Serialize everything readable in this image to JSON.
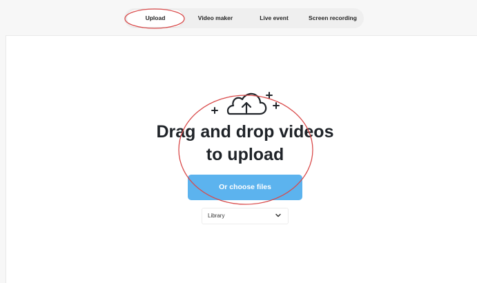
{
  "tabs": [
    {
      "label": "Upload"
    },
    {
      "label": "Video maker"
    },
    {
      "label": "Live event"
    },
    {
      "label": "Screen recording"
    }
  ],
  "upload": {
    "headline_line1": "Drag and drop videos",
    "headline_line2": "to upload",
    "choose_button": "Or choose files",
    "destination_value": "Library"
  },
  "icons": [
    "cloud-upload-icon",
    "plus-icon",
    "chevron-down-icon"
  ],
  "colors": {
    "accent": "#5cb3ee",
    "annotation": "#d94a4a",
    "text": "#1f2328"
  }
}
